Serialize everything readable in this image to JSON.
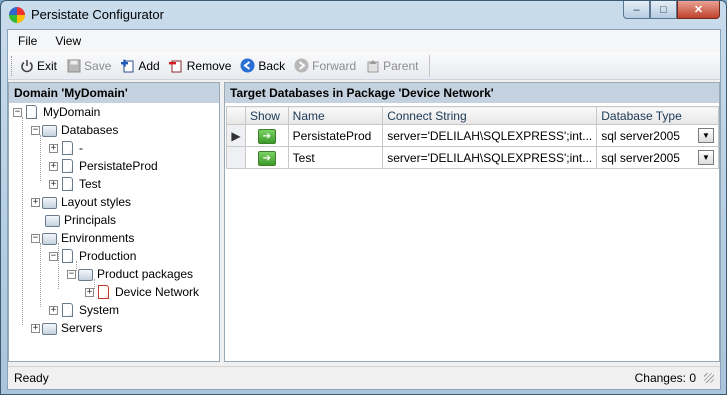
{
  "window": {
    "title": "Persistate Configurator",
    "min": "–",
    "max": "□",
    "close": "✕"
  },
  "menu": [
    "File",
    "View"
  ],
  "toolbar": {
    "exit": "Exit",
    "save": "Save",
    "add": "Add",
    "remove": "Remove",
    "back": "Back",
    "forward": "Forward",
    "parent": "Parent"
  },
  "tree": {
    "header": "Domain 'MyDomain'",
    "nodes": {
      "mydomain": "MyDomain",
      "databases": "Databases",
      "db_dash": "-",
      "db_persistateprod": "PersistateProd",
      "db_test": "Test",
      "layout_styles": "Layout styles",
      "principals": "Principals",
      "environments": "Environments",
      "production": "Production",
      "product_packages": "Product packages",
      "device_network": "Device Network",
      "system": "System",
      "servers": "Servers"
    }
  },
  "grid": {
    "title": "Target Databases in Package 'Device Network'",
    "columns": {
      "show": "Show",
      "name": "Name",
      "connect": "Connect String",
      "dbtype": "Database Type"
    },
    "rows": [
      {
        "name": "PersistateProd",
        "connect": "server='DELILAH\\SQLEXPRESS';int...",
        "dbtype": "sql server2005"
      },
      {
        "name": "Test",
        "connect": "server='DELILAH\\SQLEXPRESS';int...",
        "dbtype": "sql server2005"
      }
    ]
  },
  "status": {
    "left": "Ready",
    "right": "Changes: 0"
  }
}
